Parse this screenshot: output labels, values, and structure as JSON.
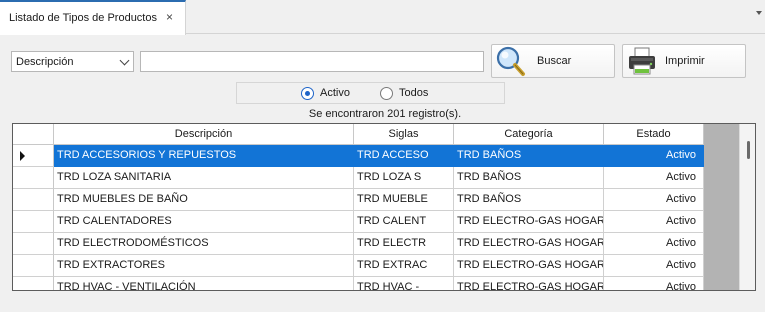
{
  "tab": {
    "title": "Listado de Tipos de Productos",
    "close_glyph": "×"
  },
  "filter": {
    "field_selected": "Descripción",
    "search_value": "",
    "search_placeholder": ""
  },
  "buttons": {
    "search_label": "Buscar",
    "print_label": "Imprimir"
  },
  "status": {
    "radio_active_label": "Activo",
    "radio_all_label": "Todos",
    "selected": "Activo"
  },
  "result_text": "Se encontraron 201 registro(s).",
  "grid": {
    "columns": [
      "Descripción",
      "Siglas",
      "Categoría",
      "Estado"
    ],
    "rows": [
      {
        "descripcion": "TRD ACCESORIOS Y REPUESTOS",
        "siglas": "TRD ACCESO",
        "categoria": "TRD BAÑOS",
        "estado": "Activo"
      },
      {
        "descripcion": "TRD LOZA SANITARIA",
        "siglas": "TRD LOZA S",
        "categoria": "TRD BAÑOS",
        "estado": "Activo"
      },
      {
        "descripcion": "TRD MUEBLES DE BAÑO",
        "siglas": "TRD MUEBLE",
        "categoria": "TRD BAÑOS",
        "estado": "Activo"
      },
      {
        "descripcion": "TRD CALENTADORES",
        "siglas": "TRD CALENT",
        "categoria": "TRD ELECTRO-GAS HOGAR",
        "estado": "Activo"
      },
      {
        "descripcion": "TRD ELECTRODOMÉSTICOS",
        "siglas": "TRD ELECTR",
        "categoria": "TRD ELECTRO-GAS HOGAR",
        "estado": "Activo"
      },
      {
        "descripcion": "TRD EXTRACTORES",
        "siglas": "TRD EXTRAC",
        "categoria": "TRD ELECTRO-GAS HOGAR",
        "estado": "Activo"
      },
      {
        "descripcion": "TRD HVAC - VENTILACIÓN",
        "siglas": "TRD HVAC -",
        "categoria": "TRD ELECTRO-GAS HOGAR",
        "estado": "Activo"
      }
    ],
    "selected_row": 0
  },
  "colors": {
    "selection": "#1274d6",
    "accent": "#1e64c8",
    "grid_bg": "#b3b3b3"
  }
}
